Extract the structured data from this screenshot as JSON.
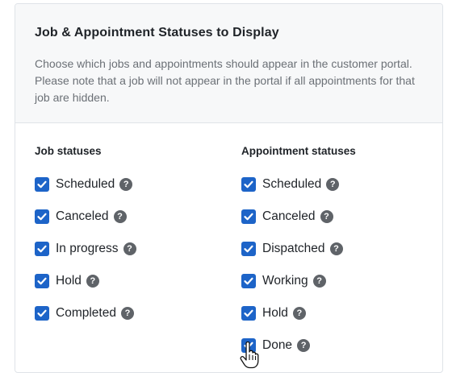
{
  "card": {
    "title": "Job & Appointment Statuses to Display",
    "description": "Choose which jobs and appointments should appear in the customer portal. Please note that a job will not appear in the portal if all appointments for that job are hidden."
  },
  "job_statuses": {
    "title": "Job statuses",
    "items": [
      {
        "label": "Scheduled",
        "checked": true
      },
      {
        "label": "Canceled",
        "checked": true
      },
      {
        "label": "In progress",
        "checked": true
      },
      {
        "label": "Hold",
        "checked": true
      },
      {
        "label": "Completed",
        "checked": true
      }
    ]
  },
  "appointment_statuses": {
    "title": "Appointment statuses",
    "items": [
      {
        "label": "Scheduled",
        "checked": true
      },
      {
        "label": "Canceled",
        "checked": true
      },
      {
        "label": "Dispatched",
        "checked": true
      },
      {
        "label": "Working",
        "checked": true
      },
      {
        "label": "Hold",
        "checked": true
      },
      {
        "label": "Done",
        "checked": true
      }
    ]
  },
  "help_glyph": "?",
  "colors": {
    "checkbox": "#1d64c8",
    "help_icon": "#5f6368",
    "header_bg": "#f7f8f9"
  }
}
